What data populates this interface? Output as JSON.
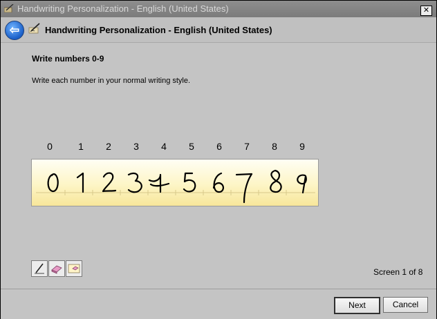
{
  "window": {
    "title": "Handwriting Personalization - English (United States)",
    "close_glyph": "✕"
  },
  "nav": {
    "back_glyph": "⇦",
    "title": "Handwriting Personalization - English (United States)"
  },
  "content": {
    "heading": "Write numbers 0-9",
    "instructions": "Write each number in your normal writing style.",
    "digit_labels": [
      "0",
      "1",
      "2",
      "3",
      "4",
      "5",
      "6",
      "7",
      "8",
      "9"
    ],
    "ink_color": "#000000",
    "pad_colors": {
      "top": "#fffef4",
      "bottom": "#f7e69a",
      "baseline": "#d8c98a"
    }
  },
  "tools": [
    {
      "name": "pen-icon",
      "label": ""
    },
    {
      "name": "eraser-icon",
      "label": ""
    },
    {
      "name": "clear-icon",
      "label": ""
    }
  ],
  "status": {
    "screen_text": "Screen 1 of 8"
  },
  "footer": {
    "next_label": "Next",
    "cancel_label": "Cancel"
  }
}
